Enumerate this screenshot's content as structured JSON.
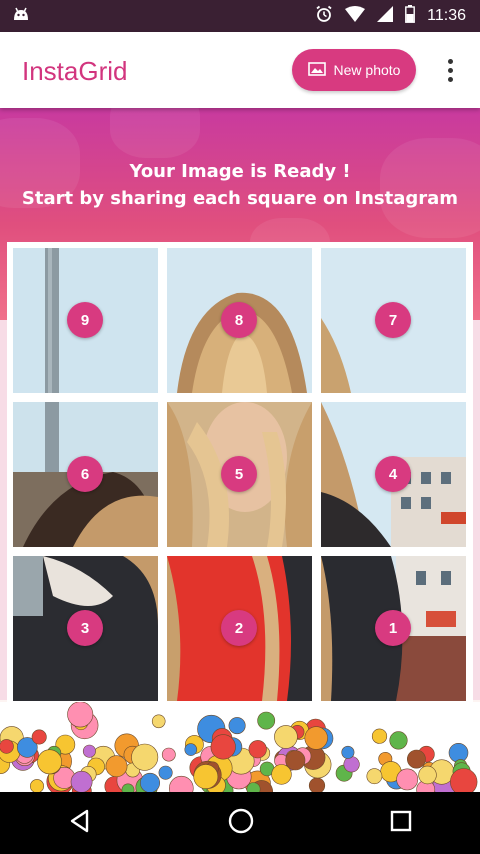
{
  "status_bar": {
    "time": "11:36",
    "icons": [
      "android-icon",
      "alarm-icon",
      "wifi-icon",
      "signal-icon",
      "battery-icon"
    ]
  },
  "app_bar": {
    "title": "InstaGrid",
    "new_photo_label": "New photo",
    "new_photo_icon": "image-icon",
    "overflow_icon": "more-vert-icon"
  },
  "banner": {
    "line1": "Your Image is Ready !",
    "line2": "Start by sharing each square on Instagram"
  },
  "grid": {
    "tiles": [
      {
        "number": "9"
      },
      {
        "number": "8"
      },
      {
        "number": "7"
      },
      {
        "number": "6"
      },
      {
        "number": "5"
      },
      {
        "number": "4"
      },
      {
        "number": "3"
      },
      {
        "number": "2"
      },
      {
        "number": "1"
      }
    ]
  },
  "nav_bar": {
    "icons": [
      "back-icon",
      "home-icon",
      "recents-icon"
    ]
  },
  "colors": {
    "accent": "#d83a80",
    "title": "#d2357e",
    "status_bar": "#3a2033",
    "banner_top": "#c83a9f",
    "banner_bottom": "#f0708a"
  }
}
